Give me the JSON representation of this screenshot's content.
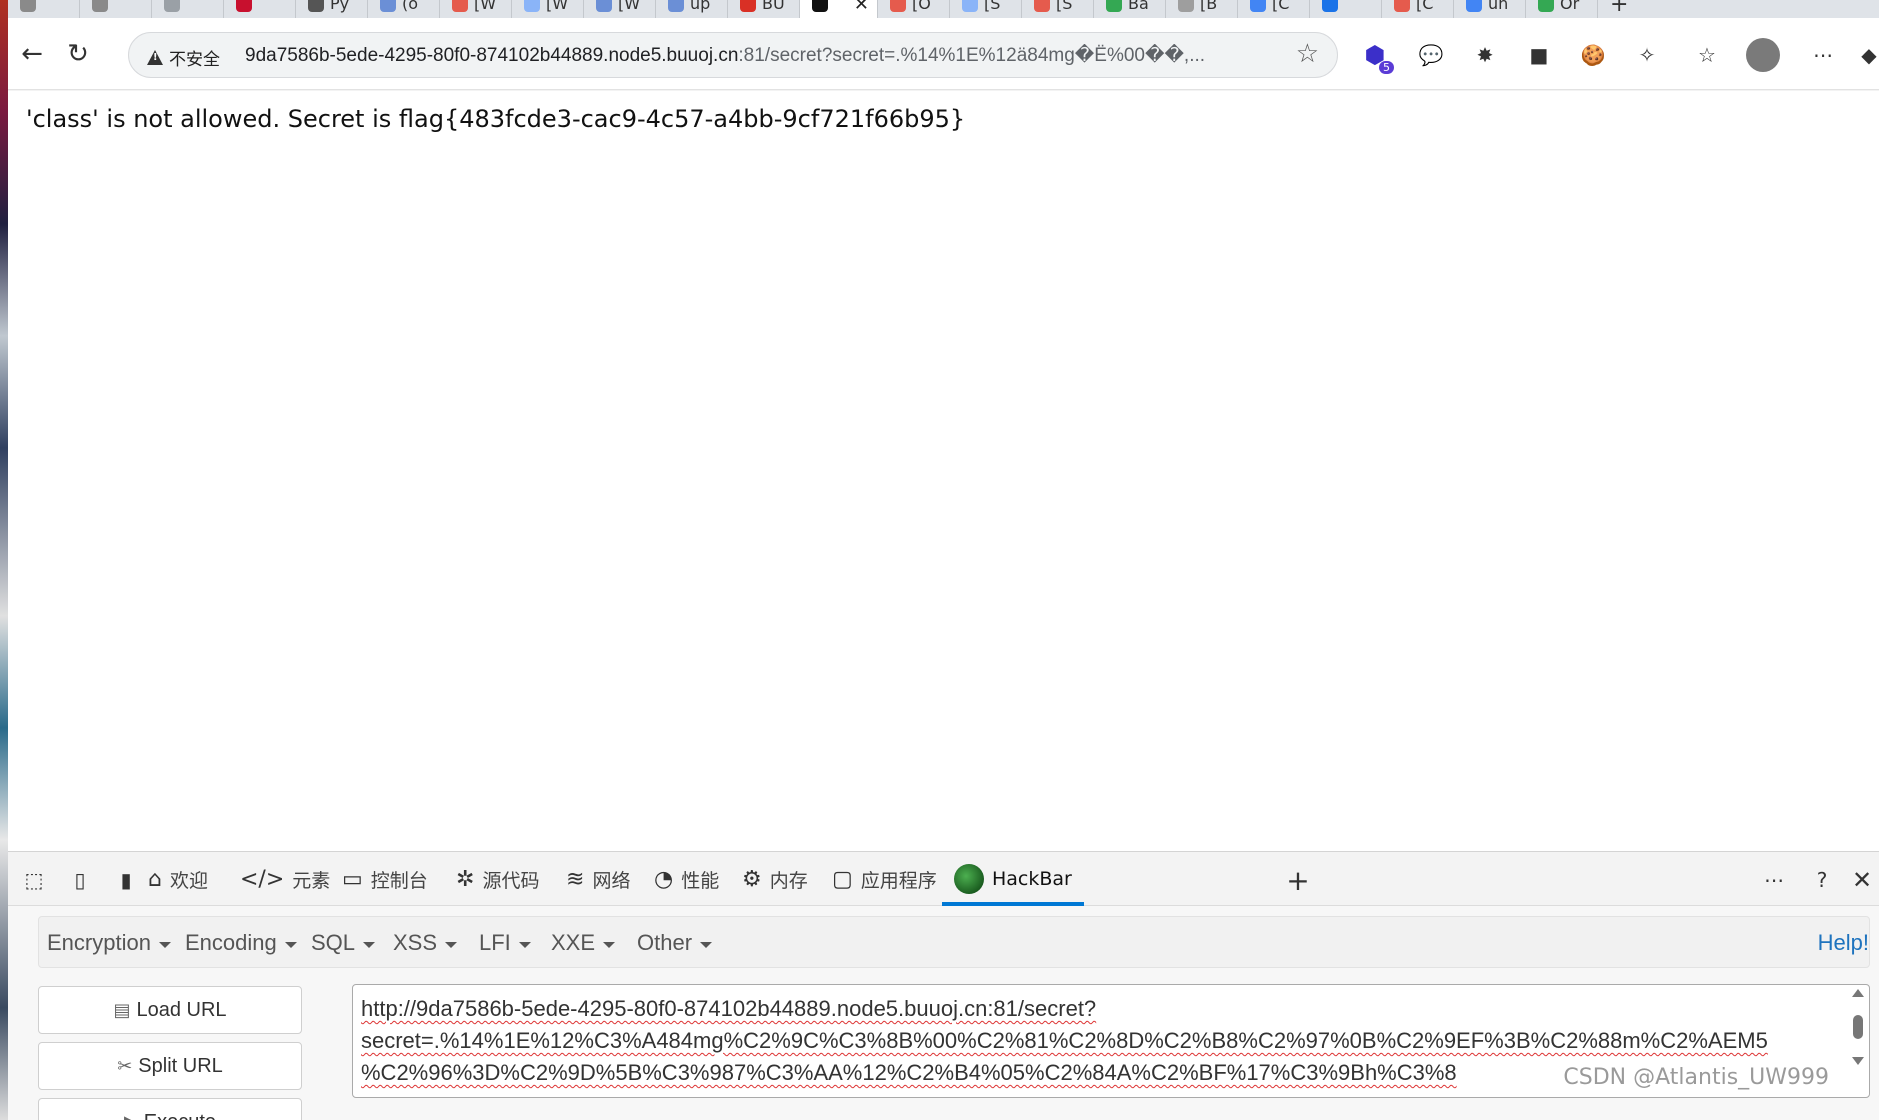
{
  "browser": {
    "tabs": [
      {
        "title": "",
        "color": "#8a8a8a"
      },
      {
        "title": "",
        "color": "#8a8a8a"
      },
      {
        "title": "",
        "color": "#9aa0a6"
      },
      {
        "title": "",
        "color": "#c8102e"
      },
      {
        "title": "Py",
        "color": "#555555"
      },
      {
        "title": "(o",
        "color": "#6b8fd6"
      },
      {
        "title": "[W",
        "color": "#e55b4d"
      },
      {
        "title": "[W",
        "color": "#8ab4f8"
      },
      {
        "title": "[W",
        "color": "#6b8fd6"
      },
      {
        "title": "up",
        "color": "#6b8fd6"
      },
      {
        "title": "BU",
        "color": "#d93025"
      },
      {
        "title": "",
        "color": "#111111",
        "active": true
      },
      {
        "title": "[O",
        "color": "#e55b4d"
      },
      {
        "title": "[S",
        "color": "#8ab4f8"
      },
      {
        "title": "[S",
        "color": "#e55b4d"
      },
      {
        "title": "Ba",
        "color": "#34a853"
      },
      {
        "title": "[B",
        "color": "#9e9e9e"
      },
      {
        "title": "[C",
        "color": "#4285f4"
      },
      {
        "title": "",
        "color": "#1a73e8"
      },
      {
        "title": "[C",
        "color": "#e55b4d"
      },
      {
        "title": "un",
        "color": "#4285f4"
      },
      {
        "title": "Or",
        "color": "#34a853"
      }
    ],
    "security_label": "不安全",
    "url_host": "9da7586b-5ede-4295-80f0-874102b44889.node5.buuoj.cn",
    "url_rest": ":81/secret?secret=.%14%1E%12ä84mg�Ë%00��,...",
    "ext_badge": "5"
  },
  "page": {
    "message": "'class' is not allowed. Secret is flag{483fcde3-cac9-4c57-a4bb-9cf721f66b95}"
  },
  "devtools": {
    "tabs": [
      {
        "label": "欢迎",
        "icon": "⌂"
      },
      {
        "label": "元素",
        "icon": "</>"
      },
      {
        "label": "控制台",
        "icon": "▭"
      },
      {
        "label": "源代码",
        "icon": "✲"
      },
      {
        "label": "网络",
        "icon": "≋"
      },
      {
        "label": "性能",
        "icon": "◔"
      },
      {
        "label": "内存",
        "icon": "⚙"
      },
      {
        "label": "应用程序",
        "icon": "▢"
      },
      {
        "label": "HackBar",
        "icon": ""
      }
    ],
    "active_tab": "HackBar"
  },
  "hackbar": {
    "menu": [
      "Encryption",
      "Encoding",
      "SQL",
      "XSS",
      "LFI",
      "XXE",
      "Other"
    ],
    "help": "Help!",
    "buttons": {
      "load": "Load URL",
      "split": "Split URL",
      "execute": "Execute"
    },
    "url_value": "http://9da7586b-5ede-4295-80f0-874102b44889.node5.buuoj.cn:81/secret?\nsecret=.%14%1E%12%C3%A484mg%C2%9C%C3%8B%00%C2%81%C2%8D%C2%B8%C2%97%0B%C2%9EF%3B%C2%88m%C2%AEM5\n%C2%96%3D%C2%9D%5B%C3%987%C3%AA%12%C2%B4%05%C2%84A%C2%BF%17%C3%9Bh%C3%8",
    "watermark": "CSDN @Atlantis_UW999"
  }
}
